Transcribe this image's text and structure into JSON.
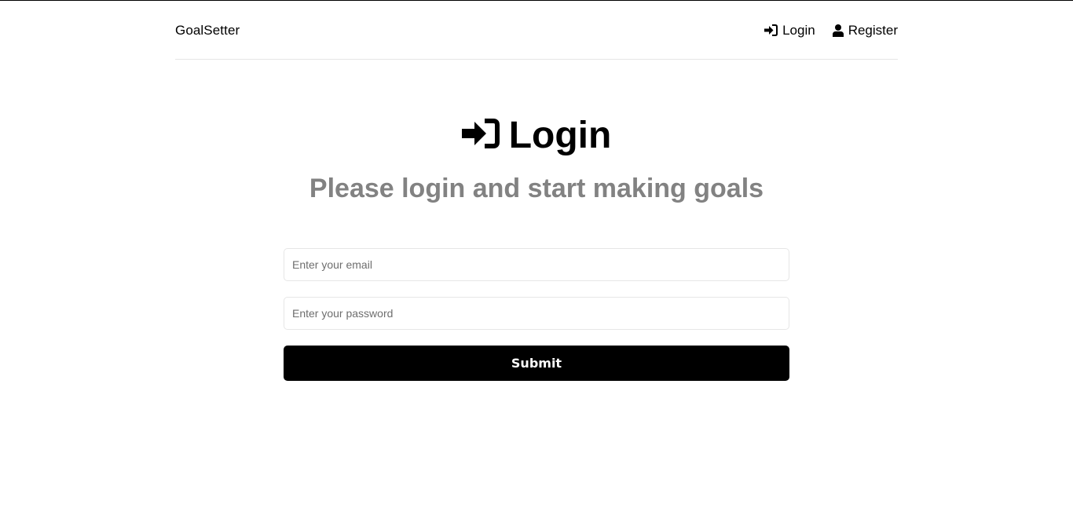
{
  "header": {
    "brand": "GoalSetter",
    "nav": {
      "login_label": "Login",
      "register_label": "Register"
    }
  },
  "main": {
    "title": "Login",
    "subtitle": "Please login and start making goals"
  },
  "form": {
    "email": {
      "value": "",
      "placeholder": "Enter your email"
    },
    "password": {
      "value": "",
      "placeholder": "Enter your password"
    },
    "submit_label": "Submit"
  },
  "colors": {
    "primary": "#000000",
    "subtitle": "#828282",
    "border": "#e6e6e6"
  },
  "icons": {
    "login": "sign-in-icon",
    "register": "user-icon"
  }
}
